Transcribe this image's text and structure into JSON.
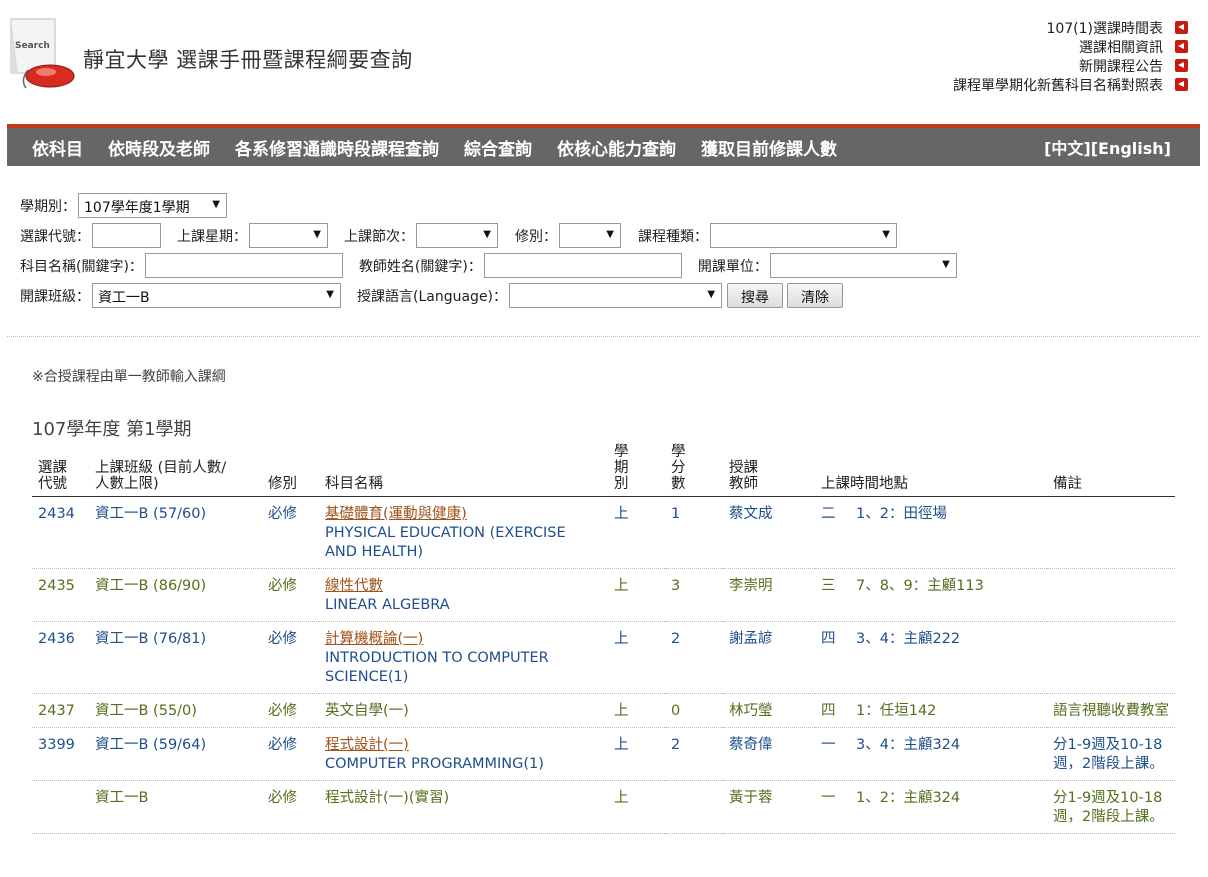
{
  "header": {
    "title": "靜宜大學 選課手冊暨課程綱要查詢",
    "logo_text": "Search",
    "links": [
      "107(1)選課時間表",
      "選課相關資訊",
      "新開課程公告",
      "課程單學期化新舊科目名稱對照表"
    ]
  },
  "nav": {
    "items": [
      "依科目",
      "依時段及老師",
      "各系修習通識時段課程查詢",
      "綜合查詢",
      "依核心能力查詢",
      "獲取目前修課人數"
    ],
    "lang": "[中文][English]"
  },
  "form": {
    "semester_label": "學期別：",
    "semester_value": "107學年度1學期",
    "code_label": "選課代號：",
    "weekday_label": "上課星期：",
    "period_label": "上課節次：",
    "required_label": "修別：",
    "type_label": "課程種類：",
    "subject_label": "科目名稱(關鍵字)：",
    "teacher_label": "教師姓名(關鍵字)：",
    "unit_label": "開課單位：",
    "class_label": "開課班級：",
    "class_value": "資工一B",
    "lang_label": "授課語言(Language)：",
    "search_button": "搜尋",
    "clear_button": "清除"
  },
  "note": "※合授課程由單一教師輸入課綱",
  "term_heading": "107學年度 第1學期",
  "table": {
    "headers": {
      "code": "選課\n代號",
      "class": "上課班級 (目前人數/\n人數上限)",
      "req": "修別",
      "name": "科目名稱",
      "term": "學\n期\n別",
      "credit": "學\n分\n數",
      "teacher": "授課\n教師",
      "time": "上課時間地點",
      "remark": "備註"
    },
    "rows": [
      {
        "code": "2434",
        "class": "資工一B (57/60)",
        "req": "必修",
        "name": "基礎體育(運動與健康)",
        "ename": "PHYSICAL EDUCATION (EXERCISE AND HEALTH)",
        "term": "上",
        "credit": "1",
        "teacher": "蔡文成",
        "day": "二",
        "time": "1、2：田徑場",
        "remark": "",
        "linked": true,
        "color": "blue"
      },
      {
        "code": "2435",
        "class": "資工一B (86/90)",
        "req": "必修",
        "name": "線性代數",
        "ename": "LINEAR ALGEBRA",
        "term": "上",
        "credit": "3",
        "teacher": "李崇明",
        "day": "三",
        "time": "7、8、9：主顧113",
        "remark": "",
        "linked": true,
        "color": "green"
      },
      {
        "code": "2436",
        "class": "資工一B (76/81)",
        "req": "必修",
        "name": "計算機概論(一)",
        "ename": "INTRODUCTION TO COMPUTER SCIENCE(1)",
        "term": "上",
        "credit": "2",
        "teacher": "謝孟諺",
        "day": "四",
        "time": "3、4：主顧222",
        "remark": "",
        "linked": true,
        "color": "blue"
      },
      {
        "code": "2437",
        "class": "資工一B (55/0)",
        "req": "必修",
        "name": "英文自學(一)",
        "ename": "",
        "term": "上",
        "credit": "0",
        "teacher": "林巧瑩",
        "day": "四",
        "time": "1：任垣142",
        "remark": "語言視聽收費教室",
        "linked": false,
        "color": "green"
      },
      {
        "code": "3399",
        "class": "資工一B (59/64)",
        "req": "必修",
        "name": "程式設計(一)",
        "ename": "COMPUTER PROGRAMMING(1)",
        "term": "上",
        "credit": "2",
        "teacher": "蔡奇偉",
        "day": "一",
        "time": "3、4：主顧324",
        "remark": "分1-9週及10-18週，2階段上課。",
        "linked": true,
        "color": "blue"
      },
      {
        "code": "",
        "class": "資工一B",
        "req": "必修",
        "name": "程式設計(一)(實習)",
        "ename": "",
        "term": "上",
        "credit": "",
        "teacher": "黃于蓉",
        "day": "一",
        "time": "1、2：主顧324",
        "remark": "分1-9週及10-18週，2階段上課。",
        "linked": false,
        "color": "green"
      }
    ]
  }
}
